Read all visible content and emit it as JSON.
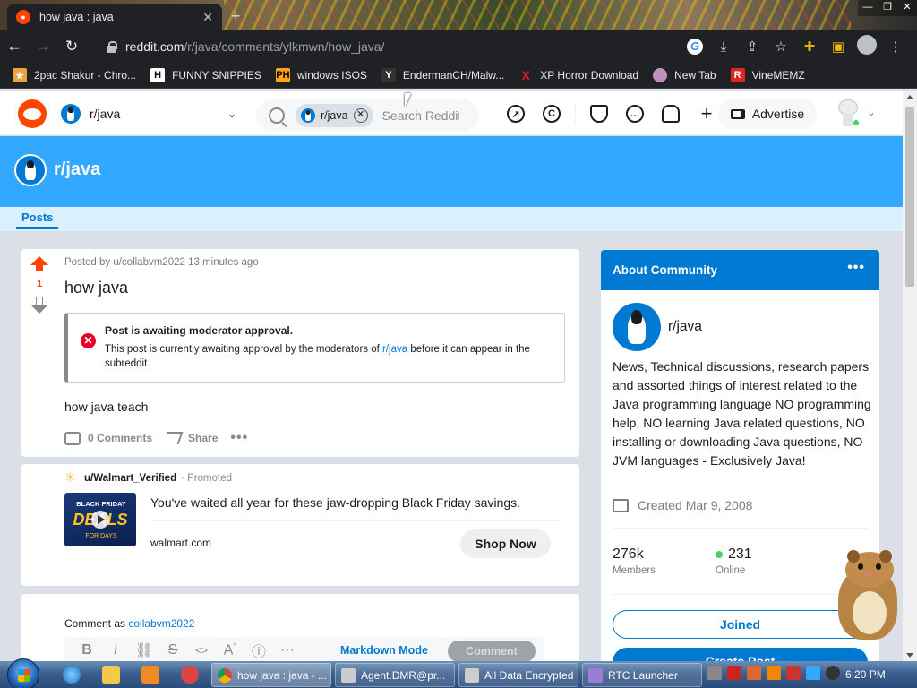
{
  "browser": {
    "tab_title": "how java : java",
    "new_tab": "+",
    "url_host": "reddit.com",
    "url_path": "/r/java/comments/ylkmwn/how_java/",
    "bookmarks": [
      {
        "label": "2pac Shakur - Chro...",
        "icon": "chrome-extension-icon",
        "color": "#e8a33d"
      },
      {
        "label": "FUNNY SNIPPIES",
        "icon": "h-icon",
        "color": "#ffffff"
      },
      {
        "label": "windows ISOS",
        "icon": "ph-icon",
        "color": "#ffa31a"
      },
      {
        "label": "EndermanCH/Malw...",
        "icon": "yp-icon",
        "color": "#333333"
      },
      {
        "label": "XP Horror Download",
        "icon": "x-icon",
        "color": "#e02020"
      },
      {
        "label": "New Tab",
        "icon": "avatar-icon",
        "color": "#c090c0"
      },
      {
        "label": "VineMEMZ",
        "icon": "r-icon",
        "color": "#e02424"
      }
    ]
  },
  "header": {
    "community": "r/java",
    "search_chip": "r/java",
    "search_placeholder": "Search Reddit",
    "advertise": "Advertise"
  },
  "banner": {
    "title": "r/java",
    "tab_posts": "Posts"
  },
  "post": {
    "meta": "Posted by u/collabvm2022 13 minutes ago",
    "score": "1",
    "title": "how java",
    "mod_title": "Post is awaiting moderator approval.",
    "mod_desc_1": "This post is currently awaiting approval by the moderators of ",
    "mod_desc_link": "r/java",
    "mod_desc_2": " before it can appear in the subreddit.",
    "body": "how java teach",
    "comments": "0 Comments",
    "share": "Share"
  },
  "promo": {
    "user": "u/Walmart_Verified",
    "promoted": "· Promoted",
    "text": "You've waited all year for these jaw-dropping Black Friday savings.",
    "domain": "walmart.com",
    "cta": "Shop Now",
    "img_line1": "BLACK FRIDAY",
    "img_line2": "DEALS",
    "img_line3": "FOR DAYS"
  },
  "comment_box": {
    "comment_as": "Comment as ",
    "username": "collabvm2022",
    "markdown_mode": "Markdown Mode",
    "comment_button": "Comment"
  },
  "about": {
    "heading": "About Community",
    "name": "r/java",
    "description": "News, Technical discussions, research papers and assorted things of interest related to the Java programming language NO programming help, NO learning Java related questions, NO installing or downloading Java questions, NO JVM languages - Exclusively Java!",
    "created": "Created Mar 9, 2008",
    "members_value": "276k",
    "members_label": "Members",
    "online_value": "231",
    "online_label": "Online",
    "joined": "Joined",
    "create_post": "Create Post"
  },
  "taskbar": {
    "buttons": [
      {
        "label": "how java : java - ...",
        "active": true
      },
      {
        "label": "Agent.DMR@pr...",
        "active": false
      },
      {
        "label": "All Data Encrypted",
        "active": false
      },
      {
        "label": "RTC Launcher",
        "active": false
      }
    ],
    "clock": "6:20 PM"
  },
  "colors": {
    "reddit_orange": "#ff4500",
    "reddit_blue": "#0079d3",
    "banner_blue": "#33a8ff",
    "online_green": "#46d160"
  }
}
